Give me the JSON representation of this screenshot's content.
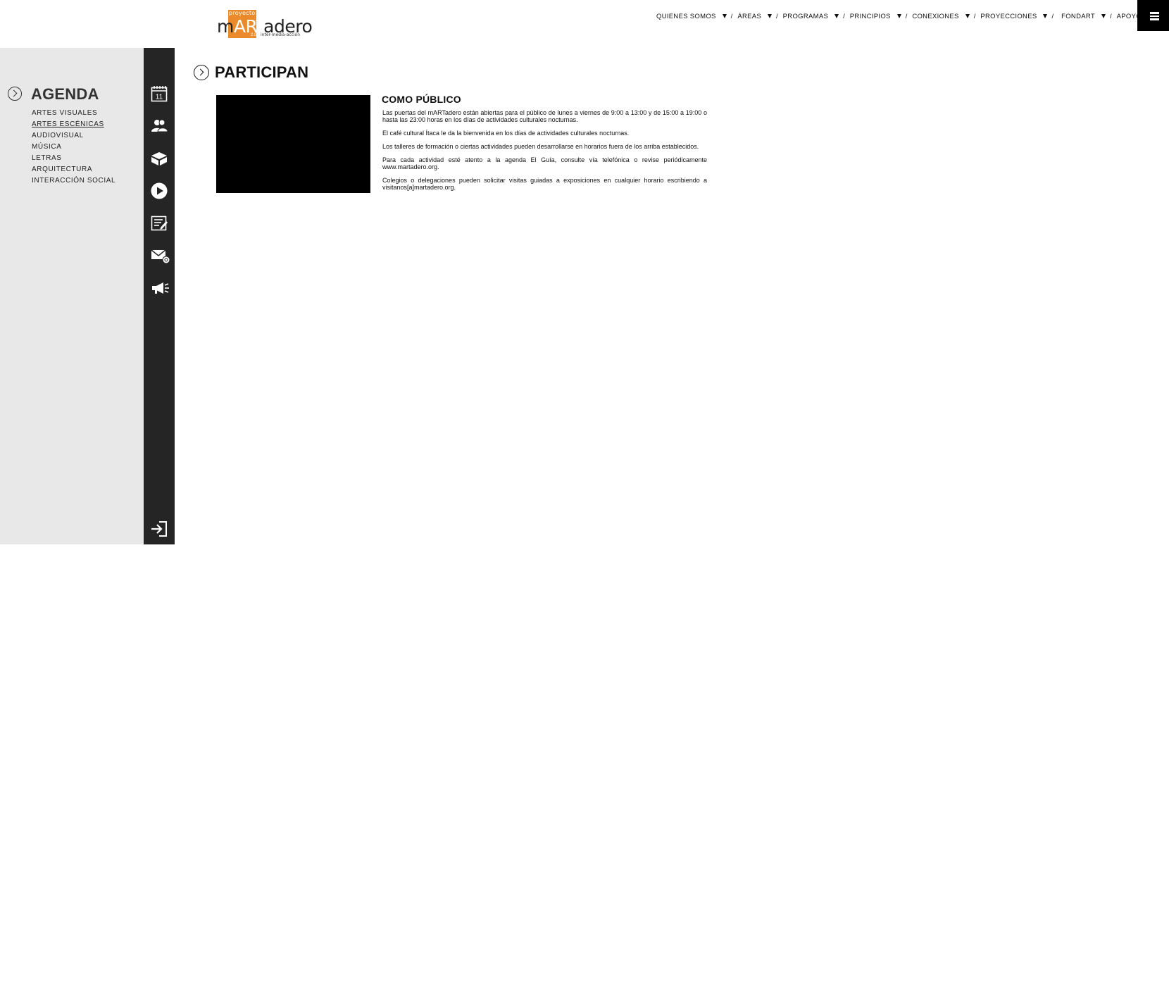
{
  "header": {
    "logo": {
      "small": "proyecto",
      "name_prefix": "m",
      "name_highlight": "ART",
      "name_suffix": "adero",
      "version": "2.0",
      "tagline": "inter-media-acción"
    },
    "nav": [
      {
        "label": "QUIENES SOMOS"
      },
      {
        "label": "ÁREAS"
      },
      {
        "label": "PROGRAMAS"
      },
      {
        "label": "PRINCIPIOS"
      },
      {
        "label": "CONEXIONES"
      },
      {
        "label": "PROYECCIONES"
      },
      {
        "label": "FONDART"
      },
      {
        "label": "APOYO"
      }
    ],
    "separator": "/"
  },
  "sidebar": {
    "title": "AGENDA",
    "items": [
      "ARTES VISUALES",
      "ARTES ESCÉNICAS",
      "AUDIOVISUAL",
      "MÚSICA",
      "LETRAS",
      "ARQUITECTURA",
      "INTERACCIÓN SOCIAL"
    ],
    "active_index": 1
  },
  "rail": {
    "icons": [
      "calendar-icon",
      "people-icon",
      "box-icon",
      "play-icon",
      "notepad-icon",
      "mail-icon",
      "megaphone-icon"
    ],
    "calendar_day": "11",
    "bottom_icon": "login-icon"
  },
  "main": {
    "title": "PARTICIPAN",
    "article": {
      "heading": "COMO PÚBLICO",
      "paragraphs": [
        "Las puertas del mARTadero están abiertas para el público de lunes a viernes de 9:00 a 13:00 y de 15:00 a 19:00 o hasta las 23:00 horas en los días de actividades culturales nocturnas.",
        "El café cultural Ítaca le da la bienvenida en los días de actividades culturales nocturnas.",
        "Los talleres de formación o ciertas actividades pueden desarrollarse en horarios fuera de los arriba establecidos.",
        "Para cada actividad esté atento a la agenda El Guía, consulte vía telefónica o revise periódicamente www.martadero.org.",
        "Colegios o delegaciones pueden solicitar visitas guiadas a exposiciones en cualquier horario escribiendo a visitanos[a]martadero.org."
      ]
    }
  },
  "colors": {
    "brand_orange": "#ea8a2b",
    "sidebar_bg": "#e8e8e8",
    "rail_bg": "#252525"
  }
}
